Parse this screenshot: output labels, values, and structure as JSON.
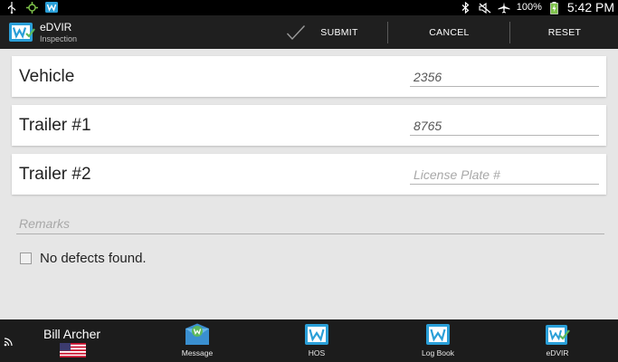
{
  "status_bar": {
    "left_icons": [
      "usb-icon",
      "location-sync-icon",
      "w-app-icon"
    ],
    "right_icons": [
      "bluetooth-icon",
      "mute-icon",
      "airplane-icon",
      "battery-charging-icon"
    ],
    "battery_percent": "100%",
    "time": "5:42 PM"
  },
  "action_bar": {
    "app_title": "eDVIR",
    "app_subtitle": "Inspection",
    "submit_label": "SUBMIT",
    "cancel_label": "CANCEL",
    "reset_label": "RESET"
  },
  "form": {
    "vehicle": {
      "label": "Vehicle",
      "value": "2356",
      "placeholder": ""
    },
    "trailer1": {
      "label": "Trailer #1",
      "value": "8765",
      "placeholder": ""
    },
    "trailer2": {
      "label": "Trailer #2",
      "value": "",
      "placeholder": "License Plate #"
    },
    "remarks": {
      "value": "",
      "placeholder": "Remarks"
    },
    "no_defects": {
      "label": "No defects found.",
      "checked": false
    }
  },
  "bottom_bar": {
    "user_name": "Bill Archer",
    "nav": [
      {
        "label": "Message",
        "icon": "message-icon"
      },
      {
        "label": "HOS",
        "icon": "hos-icon"
      },
      {
        "label": "Log Book",
        "icon": "logbook-icon"
      },
      {
        "label": "eDVIR",
        "icon": "edvir-icon"
      }
    ]
  },
  "colors": {
    "brand_blue": "#2a9fd8",
    "brand_green": "#5cb85c",
    "background": "#e6e6e6",
    "bar_dark": "#1f1f1f"
  }
}
